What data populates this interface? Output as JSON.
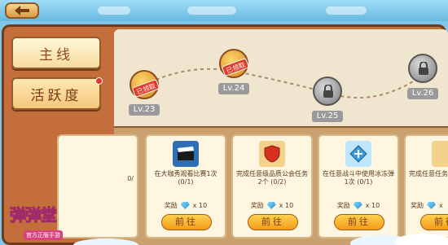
{
  "topbar": {
    "back_label": ""
  },
  "tabs": [
    {
      "label": "主线",
      "active": true,
      "has_dot": false
    },
    {
      "label": "活跃度",
      "active": false,
      "has_dot": true
    }
  ],
  "nodes": [
    {
      "level": "Lv.23",
      "state": "claimed",
      "stamp": "已领取"
    },
    {
      "level": "Lv.24",
      "state": "claimed",
      "stamp": "已领取"
    },
    {
      "level": "Lv.25",
      "state": "locked",
      "stamp": ""
    },
    {
      "level": "Lv.26",
      "state": "locked",
      "stamp": ""
    }
  ],
  "cards": [
    {
      "partial": "0/",
      "desc": "",
      "icon": "partial"
    },
    {
      "desc": "在大咖秀观看比赛1次 (0/1)",
      "reward_label": "奖励",
      "reward_amount": "x 10",
      "button": "前往",
      "icon": "clapperboard-icon"
    },
    {
      "desc": "完成任意级品质公会任务2个 (0/2)",
      "reward_label": "奖励",
      "reward_amount": "x 10",
      "button": "前往",
      "icon": "guild-shield-icon"
    },
    {
      "desc": "在任意战斗中使用冰冻弹1次 (0/1)",
      "reward_label": "奖励",
      "reward_amount": "x 10",
      "button": "前往",
      "icon": "ice-bomb-icon"
    },
    {
      "desc": "完成任意任务2个",
      "reward_label": "奖励",
      "reward_amount": "x",
      "button": "前往",
      "icon": "partial-icon"
    }
  ],
  "logo": {
    "title": "弹弹堂",
    "sub": "官方正版手游"
  },
  "colors": {
    "accent": "#f39a1a",
    "panel": "#c46e3c",
    "stamp": "#e33b2a"
  }
}
